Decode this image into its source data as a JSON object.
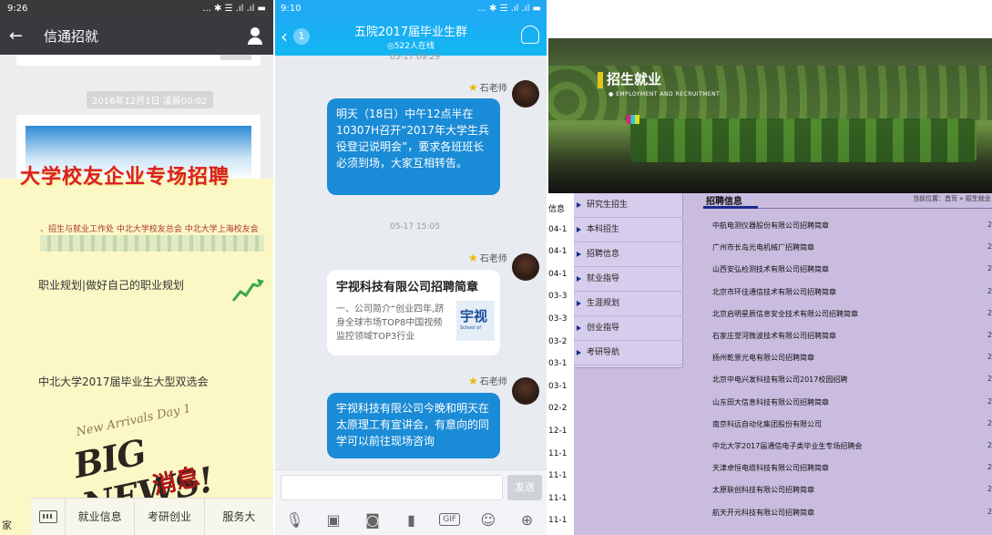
{
  "wechat": {
    "status_time": "9:26",
    "status_icons": "... ✱ ☰ .ıl .ıl ▬",
    "title": "信通招就",
    "timestamp": "2016年12月1日 凌晨00:02",
    "banner_title": "大学校友企业专场招聘",
    "banner_subline": "、招生与就业工作处 中北大学校友总会 中北大学上海校友会",
    "article_1": "职业规划|做好自己的职业规划",
    "article_2": "中北大学2017届毕业生大型双选会",
    "big_news_script": "New Arrivals Day 1",
    "big_news": "BIG NEWS!",
    "big_news_cn": "消息",
    "bottom_left_char": "家",
    "tabs": [
      "就业信息",
      "考研创业",
      "服务大"
    ]
  },
  "qq": {
    "status_time": "9:10",
    "status_icons": "... ✱ ☰ .ıl .ıl ▬",
    "back_count": "1",
    "group_name": "五院2017届毕业生群",
    "online": "◎522人在线",
    "top_timestamp": "05-17 09:29",
    "sender": "石老师",
    "message_1": "明天（18日）中午12点半在10307H召开“2017年大学生兵役登记说明会”，要求各班班长必须到场，大家互相转告。",
    "mid_timestamp": "05-17 15:05",
    "share_title": "宇视科技有限公司招聘简章",
    "share_desc": "一、公司简介“创业四年,跻身全球市场TOP8中国视频监控领域TOP3行业",
    "share_logo": "宇视",
    "share_logo_sub": "School of",
    "message_3": "宇视科技有限公司今晚和明天在太原理工有宣讲会，有意向的同学可以前往现场咨询",
    "send_label": "发送",
    "toolbar_icons": [
      "mic-icon",
      "image-icon",
      "camera-icon",
      "red-packet-icon",
      "gif-icon",
      "emoji-icon",
      "plus-icon"
    ],
    "gif_label": "GIF"
  },
  "site": {
    "brand": "招生就业",
    "brand_sub": "● EMPLOYMENT AND RECRUITMENT",
    "nav": [
      "研究生招生",
      "本科招生",
      "招聘信息",
      "就业指导",
      "生涯规划",
      "创业指导",
      "考研导航"
    ],
    "left_numbers": [
      "信息",
      "04-1",
      "04-1",
      "04-1",
      "03-3",
      "03-3",
      "03-2",
      "03-1",
      "03-1",
      "02-2",
      "12-1",
      "11-1",
      "11-1",
      "11-1",
      "11-1"
    ],
    "section_title": "招聘信息",
    "breadcrumb": "当前位置：首页 » 招生就业",
    "rows": [
      "中航电测仪器股份有限公司招聘简章",
      "广州市长岛光电机械厂招聘简章",
      "山西安弘检测技术有限公司招聘简章",
      "北京市环佳通信技术有限公司招聘简章",
      "北京启明星辰信息安全技术有限公司招聘简章",
      "石家庄誉河微波技术有限公司招聘简章",
      "扬州乾景光电有限公司招聘简章",
      "北京中电兴发科技有限公司2017校园招聘",
      "山东田大信息科技有限公司招聘简章",
      "南京科远自动化集团股份有限公司",
      "中北大学2017届通信电子类毕业生专场招聘会",
      "天津卓恒电缆科技有限公司招聘简章",
      "太原联创科技有限公司招聘简章",
      "航天开元科技有限公司招聘简章"
    ],
    "row_suffix": "2"
  }
}
